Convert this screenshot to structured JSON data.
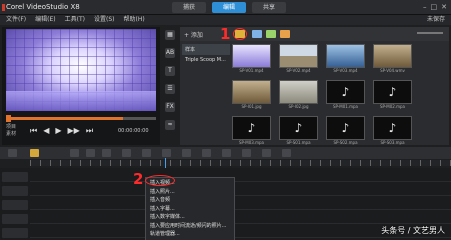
{
  "window": {
    "title": "Corel VideoStudio X8",
    "controls": [
      "–",
      "□",
      "✕"
    ]
  },
  "top_tabs": [
    {
      "label": "捕获",
      "active": false
    },
    {
      "label": "编辑",
      "active": true
    },
    {
      "label": "共享",
      "active": false
    }
  ],
  "menu": {
    "items": [
      "文件(F)",
      "编辑(E)",
      "工具(T)",
      "设置(S)",
      "帮助(H)"
    ],
    "right_label": "未保存"
  },
  "preview": {
    "mode_labels": [
      "项目",
      "素材"
    ],
    "transport_icons": [
      "⏮",
      "◀",
      "▶",
      "▶▶",
      "⏭"
    ],
    "timecode": "00:00:00:00"
  },
  "side_tools": [
    "▦",
    "AB",
    "T",
    "☰",
    "FX",
    "≈"
  ],
  "annotations": {
    "step1": "1",
    "step2": "2"
  },
  "library": {
    "add_label": "+ 添加",
    "folders": [
      {
        "label": "样本",
        "selected": true
      },
      {
        "label": "Triple Scoop M...",
        "selected": false
      }
    ],
    "colors": {
      "folder": "#e0b23a",
      "video": "#7fb3e8",
      "photo": "#9bd36b",
      "audio": "#e6a14a"
    },
    "thumbnails": [
      {
        "caption": "SP-V01.mp4",
        "style": "t-purple",
        "icon": ""
      },
      {
        "caption": "SP-V02.mp4",
        "style": "t-field",
        "icon": ""
      },
      {
        "caption": "SP-V03.mp4",
        "style": "t-ocean",
        "icon": ""
      },
      {
        "caption": "SP-V04.wmv",
        "style": "t-sand",
        "icon": ""
      },
      {
        "caption": "SP-I01.jpg",
        "style": "t-sand",
        "icon": ""
      },
      {
        "caption": "SP-I02.jpg",
        "style": "t-tree",
        "icon": ""
      },
      {
        "caption": "SP-M01.mpa",
        "style": "t-audio",
        "icon": "♪"
      },
      {
        "caption": "SP-M02.mpa",
        "style": "t-audio",
        "icon": "♪"
      },
      {
        "caption": "SP-M03.mpa",
        "style": "t-audio",
        "icon": "♪"
      },
      {
        "caption": "SP-S01.mpa",
        "style": "t-audio",
        "icon": "♪"
      },
      {
        "caption": "SP-S02.mpa",
        "style": "t-audio",
        "icon": "♪"
      },
      {
        "caption": "SP-S03.mpa",
        "style": "t-audio",
        "icon": "♪"
      }
    ]
  },
  "context_menu": {
    "items": [
      "插入视频...",
      "插入照片...",
      "插入音频",
      "插入字幕...",
      "插入数字媒体...",
      "插入要应用时间流逝/频闪的照片...",
      "轨道管理器..."
    ]
  },
  "watermark": "头条号 / 文艺男人"
}
